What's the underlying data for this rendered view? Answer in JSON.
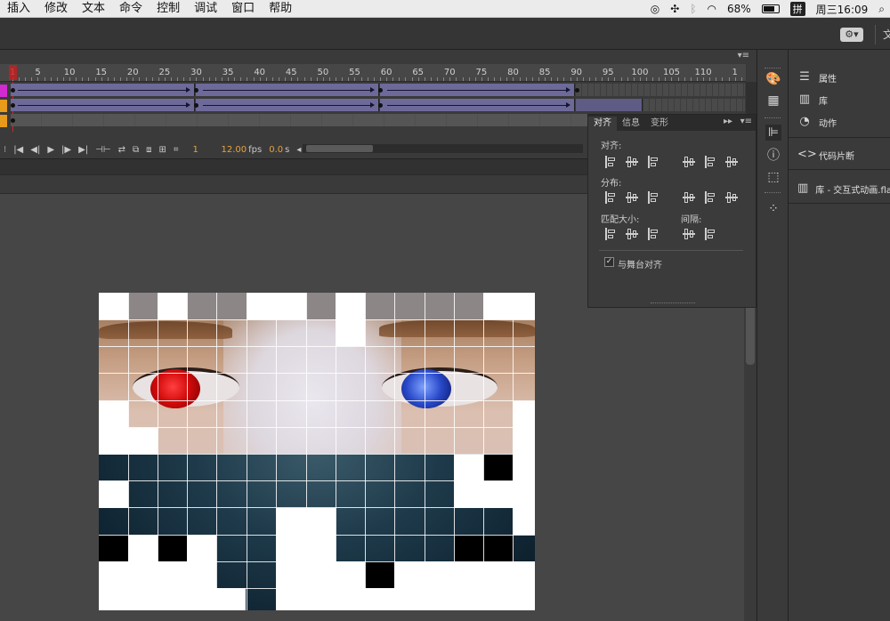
{
  "menubar": {
    "items": [
      "插入",
      "修改",
      "文本",
      "命令",
      "控制",
      "调试",
      "窗口",
      "帮助"
    ],
    "battery": "68%",
    "input_method": "拼",
    "clock": "周三16:09"
  },
  "toolbar": {
    "cut_text": "文"
  },
  "timeline": {
    "ruler_labels": [
      "1",
      "5",
      "10",
      "15",
      "20",
      "25",
      "30",
      "35",
      "40",
      "45",
      "50",
      "55",
      "60",
      "65",
      "70",
      "75",
      "80",
      "85",
      "90",
      "95",
      "100",
      "105",
      "110",
      "1"
    ],
    "current_frame": "1",
    "fps": "12.00",
    "fps_unit": "fps",
    "elapsed": "0.0",
    "elapsed_unit": "s",
    "layer_colors": [
      "#d12ad1",
      "#e89a1a",
      "#e89a1a"
    ]
  },
  "align_panel": {
    "tabs": [
      "对齐",
      "信息",
      "变形"
    ],
    "align_label": "对齐:",
    "distribute_label": "分布:",
    "match_size_label": "匹配大小:",
    "spacing_label": "间隔:",
    "align_to_stage": "与舞台对齐",
    "align_to_stage_checked": true
  },
  "right_panels": {
    "items": [
      "属性",
      "库",
      "动作",
      "代码片断",
      "库 - 交互式动画.fla"
    ]
  }
}
